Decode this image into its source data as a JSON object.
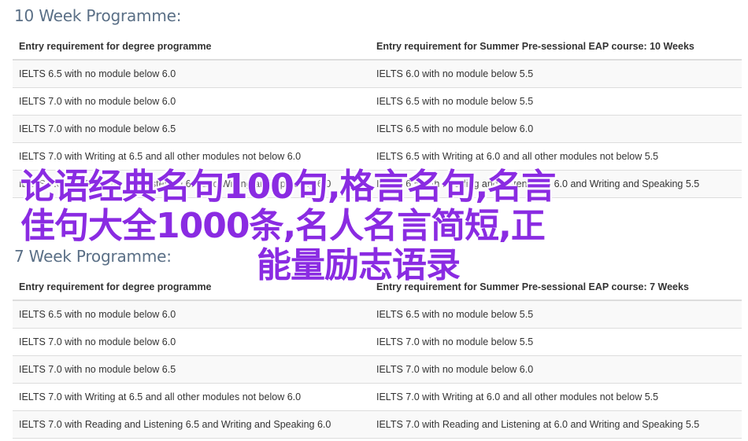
{
  "section1": {
    "heading": "10 Week Programme:",
    "headers": [
      "Entry requirement for degree programme",
      "Entry requirement for Summer Pre-sessional EAP course: 10 Weeks"
    ],
    "rows": [
      [
        "IELTS 6.5 with no module below 6.0",
        "IELTS 6.0 with no module below 5.5"
      ],
      [
        "IELTS 7.0 with no module below 6.0",
        "IELTS 6.5 with no module below 5.5"
      ],
      [
        "IELTS 7.0 with no module below 6.5",
        "IELTS 6.5 with no module below 6.0"
      ],
      [
        "IELTS 7.0 with Writing at 6.5 and all other modules not below 6.0",
        "IELTS 6.5 with Writing at 6.0 and all other modules not below 5.5"
      ],
      [
        "IELTS 7.0 with Reading and Listening 6.5 and Writing and Speaking 6.0",
        "IELTS 6.5 with Reading and Listening at 6.0 and Writing and Speaking 5.5"
      ]
    ]
  },
  "section2": {
    "heading": "7 Week Programme:",
    "headers": [
      "Entry requirement for degree programme",
      "Entry requirement for Summer Pre-sessional EAP course: 7 Weeks"
    ],
    "rows": [
      [
        "IELTS 6.5 with no module below 6.0",
        "IELTS 6.5 with no module below 5.5"
      ],
      [
        "IELTS 7.0 with no module below 6.0",
        "IELTS 7.0 with no module below 5.5"
      ],
      [
        "IELTS 7.0 with no module below 6.5",
        "IELTS 7.0 with no module below 6.0"
      ],
      [
        "IELTS 7.0 with Writing at 6.5 and all other modules not below 6.0",
        "IELTS 7.0 with Writing at 6.0 and all other modules not below 5.5"
      ],
      [
        "IELTS 7.0 with Reading and Listening 6.5 and Writing and Speaking 6.0",
        "IELTS 7.0 with Reading and Listening at 6.0 and Writing and Speaking 5.5"
      ]
    ]
  },
  "overlay": {
    "line1": "论语经典名句100句,格言名句,名言",
    "line2": "佳句大全1000条,名人名言简短,正",
    "line3": "能量励志语录",
    "color": "#8a2be2"
  }
}
